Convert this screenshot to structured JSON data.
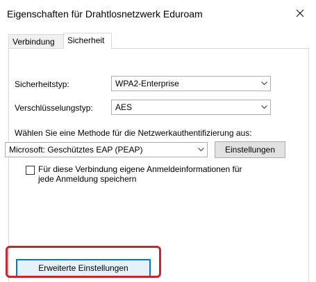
{
  "window": {
    "title": "Eigenschaften für Drahtlosnetzwerk Eduroam",
    "close_icon": "close-icon"
  },
  "tabs": [
    {
      "label": "Verbindung",
      "selected": false
    },
    {
      "label": "Sicherheit",
      "selected": true
    }
  ],
  "security": {
    "type_label": "Sicherheitstyp:",
    "type_value": "WPA2-Enterprise",
    "encryption_label": "Verschlüsselungstyp:",
    "encryption_value": "AES"
  },
  "auth": {
    "method_label": "Wählen Sie eine Methode für die Netzwerkauthentifizierung aus:",
    "method_value": "Microsoft: Geschütztes EAP (PEAP)",
    "settings_button": "Einstellungen",
    "remember_line1": "Für diese Verbindung eigene Anmeldeinformationen für",
    "remember_line2": "jede Anmeldung speichern",
    "remember_checked": false
  },
  "advanced_button": "Erweiterte Einstellungen",
  "colors": {
    "highlight": "#c8262d",
    "focus_border": "#0078d7"
  }
}
